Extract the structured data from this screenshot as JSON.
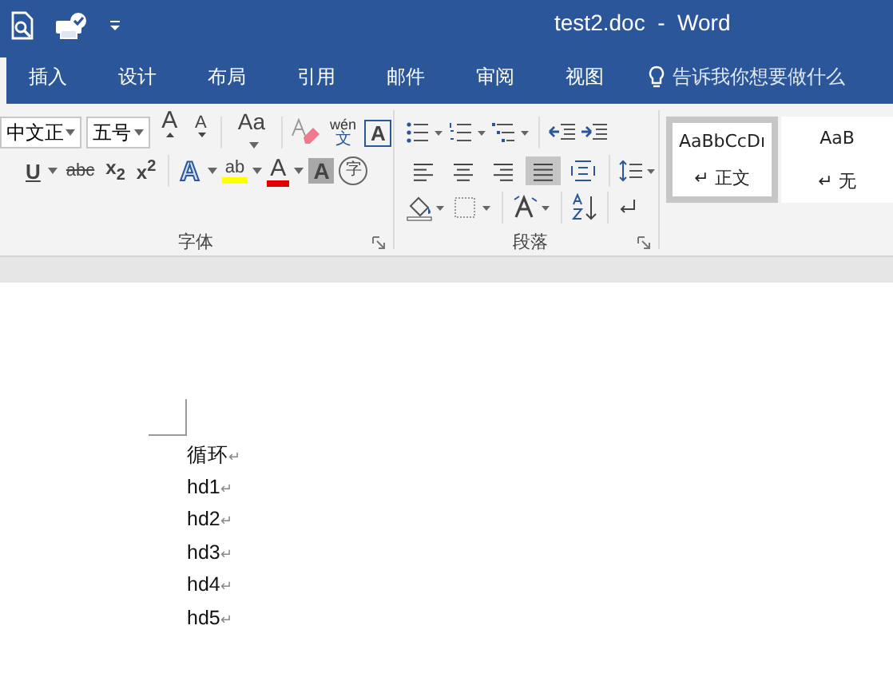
{
  "window": {
    "title": "test2.doc  -  Word"
  },
  "tabs": [
    {
      "label": "插入",
      "selected": false
    },
    {
      "label": "设计",
      "selected": false
    },
    {
      "label": "布局",
      "selected": false
    },
    {
      "label": "引用",
      "selected": false
    },
    {
      "label": "邮件",
      "selected": false
    },
    {
      "label": "审阅",
      "selected": false
    },
    {
      "label": "视图",
      "selected": false
    }
  ],
  "tell_me": {
    "placeholder": "告诉我你想要做什么"
  },
  "font_group": {
    "label": "字体",
    "font_name": "中文正",
    "font_size": "五号",
    "grow": "A",
    "shrink": "A",
    "change_case": "Aa",
    "phonetic_top": "wén",
    "phonetic_bottom": "文",
    "char_border": "A",
    "underline": "U",
    "strikethrough": "abc",
    "subscript": "x$_{2}$",
    "superscript": "x$^{2}$",
    "text_effect": "A",
    "highlight": "ab",
    "font_color": "A",
    "char_shading": "A",
    "enclose": "字"
  },
  "paragraph_group": {
    "label": "段落",
    "align": [
      {
        "kind": "left",
        "selected": false
      },
      {
        "kind": "center",
        "selected": false
      },
      {
        "kind": "right",
        "selected": false
      },
      {
        "kind": "justify",
        "selected": true
      },
      {
        "kind": "distribute",
        "selected": false
      }
    ]
  },
  "styles": [
    {
      "sample": "AaBbCcDı",
      "name": "正文",
      "mark": "↵",
      "selected": true
    },
    {
      "sample": "AaB",
      "name": "无",
      "mark": "↵",
      "selected": false
    }
  ],
  "document": {
    "lines": [
      {
        "text": "循环",
        "mark": "↵"
      },
      {
        "text": "hd1",
        "mark": "↵"
      },
      {
        "text": "hd2",
        "mark": "↵"
      },
      {
        "text": "hd3",
        "mark": "↵"
      },
      {
        "text": "hd4",
        "mark": "↵"
      },
      {
        "text": "hd5",
        "mark": "↵"
      }
    ]
  }
}
